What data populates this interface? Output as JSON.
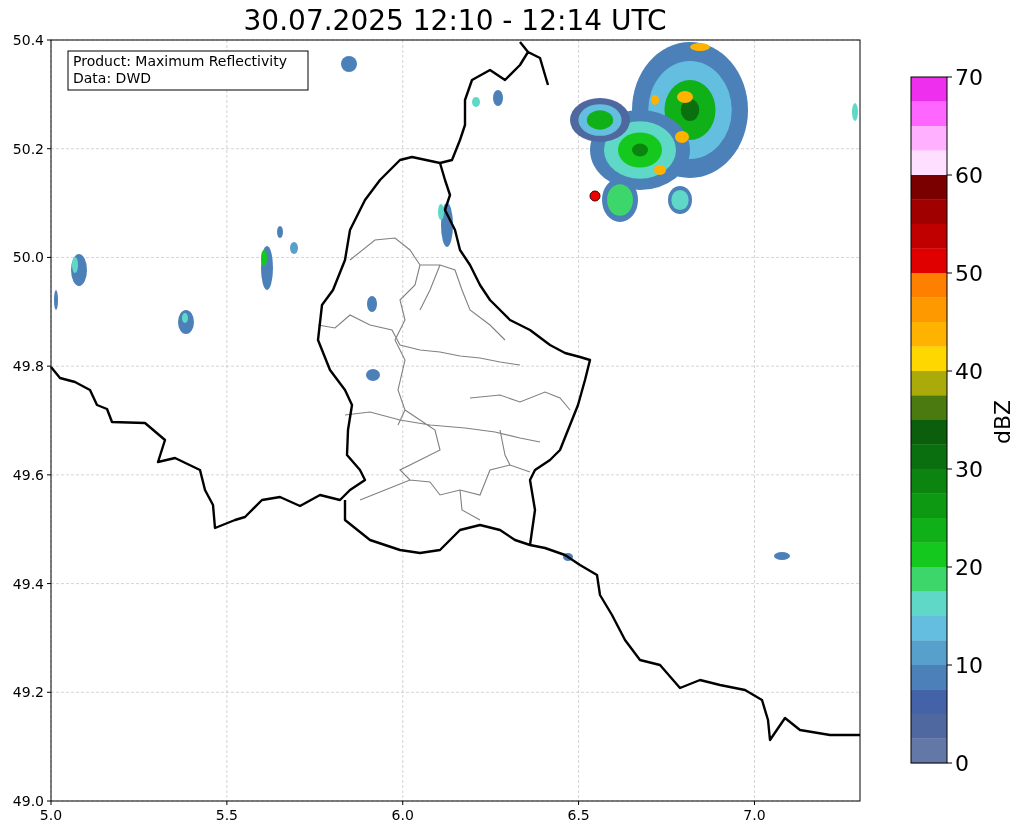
{
  "title": "30.07.2025 12:10 - 12:14 UTC",
  "info_box": [
    "Product: Maximum Reflectivity",
    "Data: DWD"
  ],
  "x_ticks": [
    "5.0",
    "5.5",
    "6.0",
    "6.5",
    "7.0"
  ],
  "y_ticks": [
    "50.4",
    "50.2",
    "50.0",
    "49.8",
    "49.6",
    "49.4",
    "49.2",
    "49.0"
  ],
  "colorbar": {
    "label": "dBZ",
    "ticks": [
      "70",
      "60",
      "50",
      "40",
      "30",
      "20",
      "10",
      "0"
    ],
    "segments": [
      {
        "color": "#ee30ee"
      },
      {
        "color": "#ff66ff"
      },
      {
        "color": "#ffb0ff"
      },
      {
        "color": "#ffdfff"
      },
      {
        "color": "#7a0000"
      },
      {
        "color": "#a00000"
      },
      {
        "color": "#c00000"
      },
      {
        "color": "#e00000"
      },
      {
        "color": "#ff7f00"
      },
      {
        "color": "#ff9900"
      },
      {
        "color": "#ffb300"
      },
      {
        "color": "#ffd700"
      },
      {
        "color": "#aaaa0a"
      },
      {
        "color": "#4a7a10"
      },
      {
        "color": "#0b5e0b"
      },
      {
        "color": "#0a700f"
      },
      {
        "color": "#0b8510"
      },
      {
        "color": "#0d9a12"
      },
      {
        "color": "#10b018"
      },
      {
        "color": "#14c81d"
      },
      {
        "color": "#3cd66a"
      },
      {
        "color": "#60d8c8"
      },
      {
        "color": "#64bee0"
      },
      {
        "color": "#58a0cc"
      },
      {
        "color": "#4c80b8"
      },
      {
        "color": "#4462a8"
      },
      {
        "color": "#5068a0"
      },
      {
        "color": "#6478a8"
      }
    ]
  }
}
